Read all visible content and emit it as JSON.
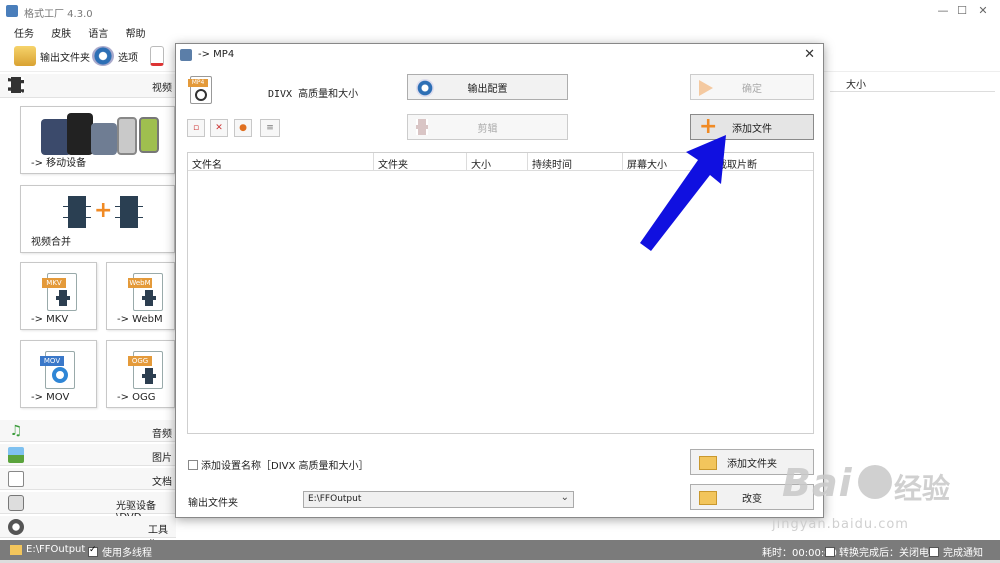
{
  "main_window": {
    "title": "格式工厂 4.3.0",
    "menu": [
      "任务",
      "皮肤",
      "语言",
      "帮助"
    ],
    "toolbar": {
      "output_folder_label": "输出文件夹",
      "options_label": "选项"
    },
    "sidebar": {
      "video_category": "视频",
      "tiles": {
        "mobile": "-> 移动设备",
        "merge": "视频合并",
        "mkv": "-> MKV",
        "webm": "-> WebM",
        "mov": "-> MOV",
        "ogg": "-> OGG"
      },
      "doc_tags": {
        "mkv": "MKV",
        "webm": "WebM",
        "mov": "MOV",
        "ogg": "OGG"
      },
      "categories": [
        "音频",
        "图片",
        "文档",
        "光驱设备\\DVD",
        "工具集"
      ]
    },
    "right_panel_header": "大小",
    "status_bar": {
      "output_path": "E:\\FFOutput",
      "multithread_label": "使用多线程",
      "elapsed": "耗时：00:00:00",
      "after_convert": "转换完成后：关闭电脑",
      "notify": "完成通知"
    }
  },
  "dialog": {
    "title": "-> MP4",
    "format_title": "DIVX 高质量和大小",
    "format_icon_tag": "MP4",
    "output_config_label": "输出配置",
    "ok_label": "确定",
    "clip_label": "剪辑",
    "add_file_label": "添加文件",
    "add_folder_label": "添加文件夹",
    "change_label": "改变",
    "columns": [
      "文件名",
      "文件夹",
      "大小",
      "持续时间",
      "屏幕大小",
      "截取片断"
    ],
    "add_setting_name": "添加设置名称［DIVX 高质量和大小］",
    "output_folder_label": "输出文件夹",
    "output_folder_value": "E:\\FFOutput"
  },
  "watermark": {
    "brand_main": "Bai",
    "brand_sub": "经验",
    "url": "jingyan.baidu.com"
  },
  "colors": {
    "annotation_arrow": "#1010e0",
    "status_bar": "#7b7b7b",
    "accent_orange": "#f08a24"
  }
}
